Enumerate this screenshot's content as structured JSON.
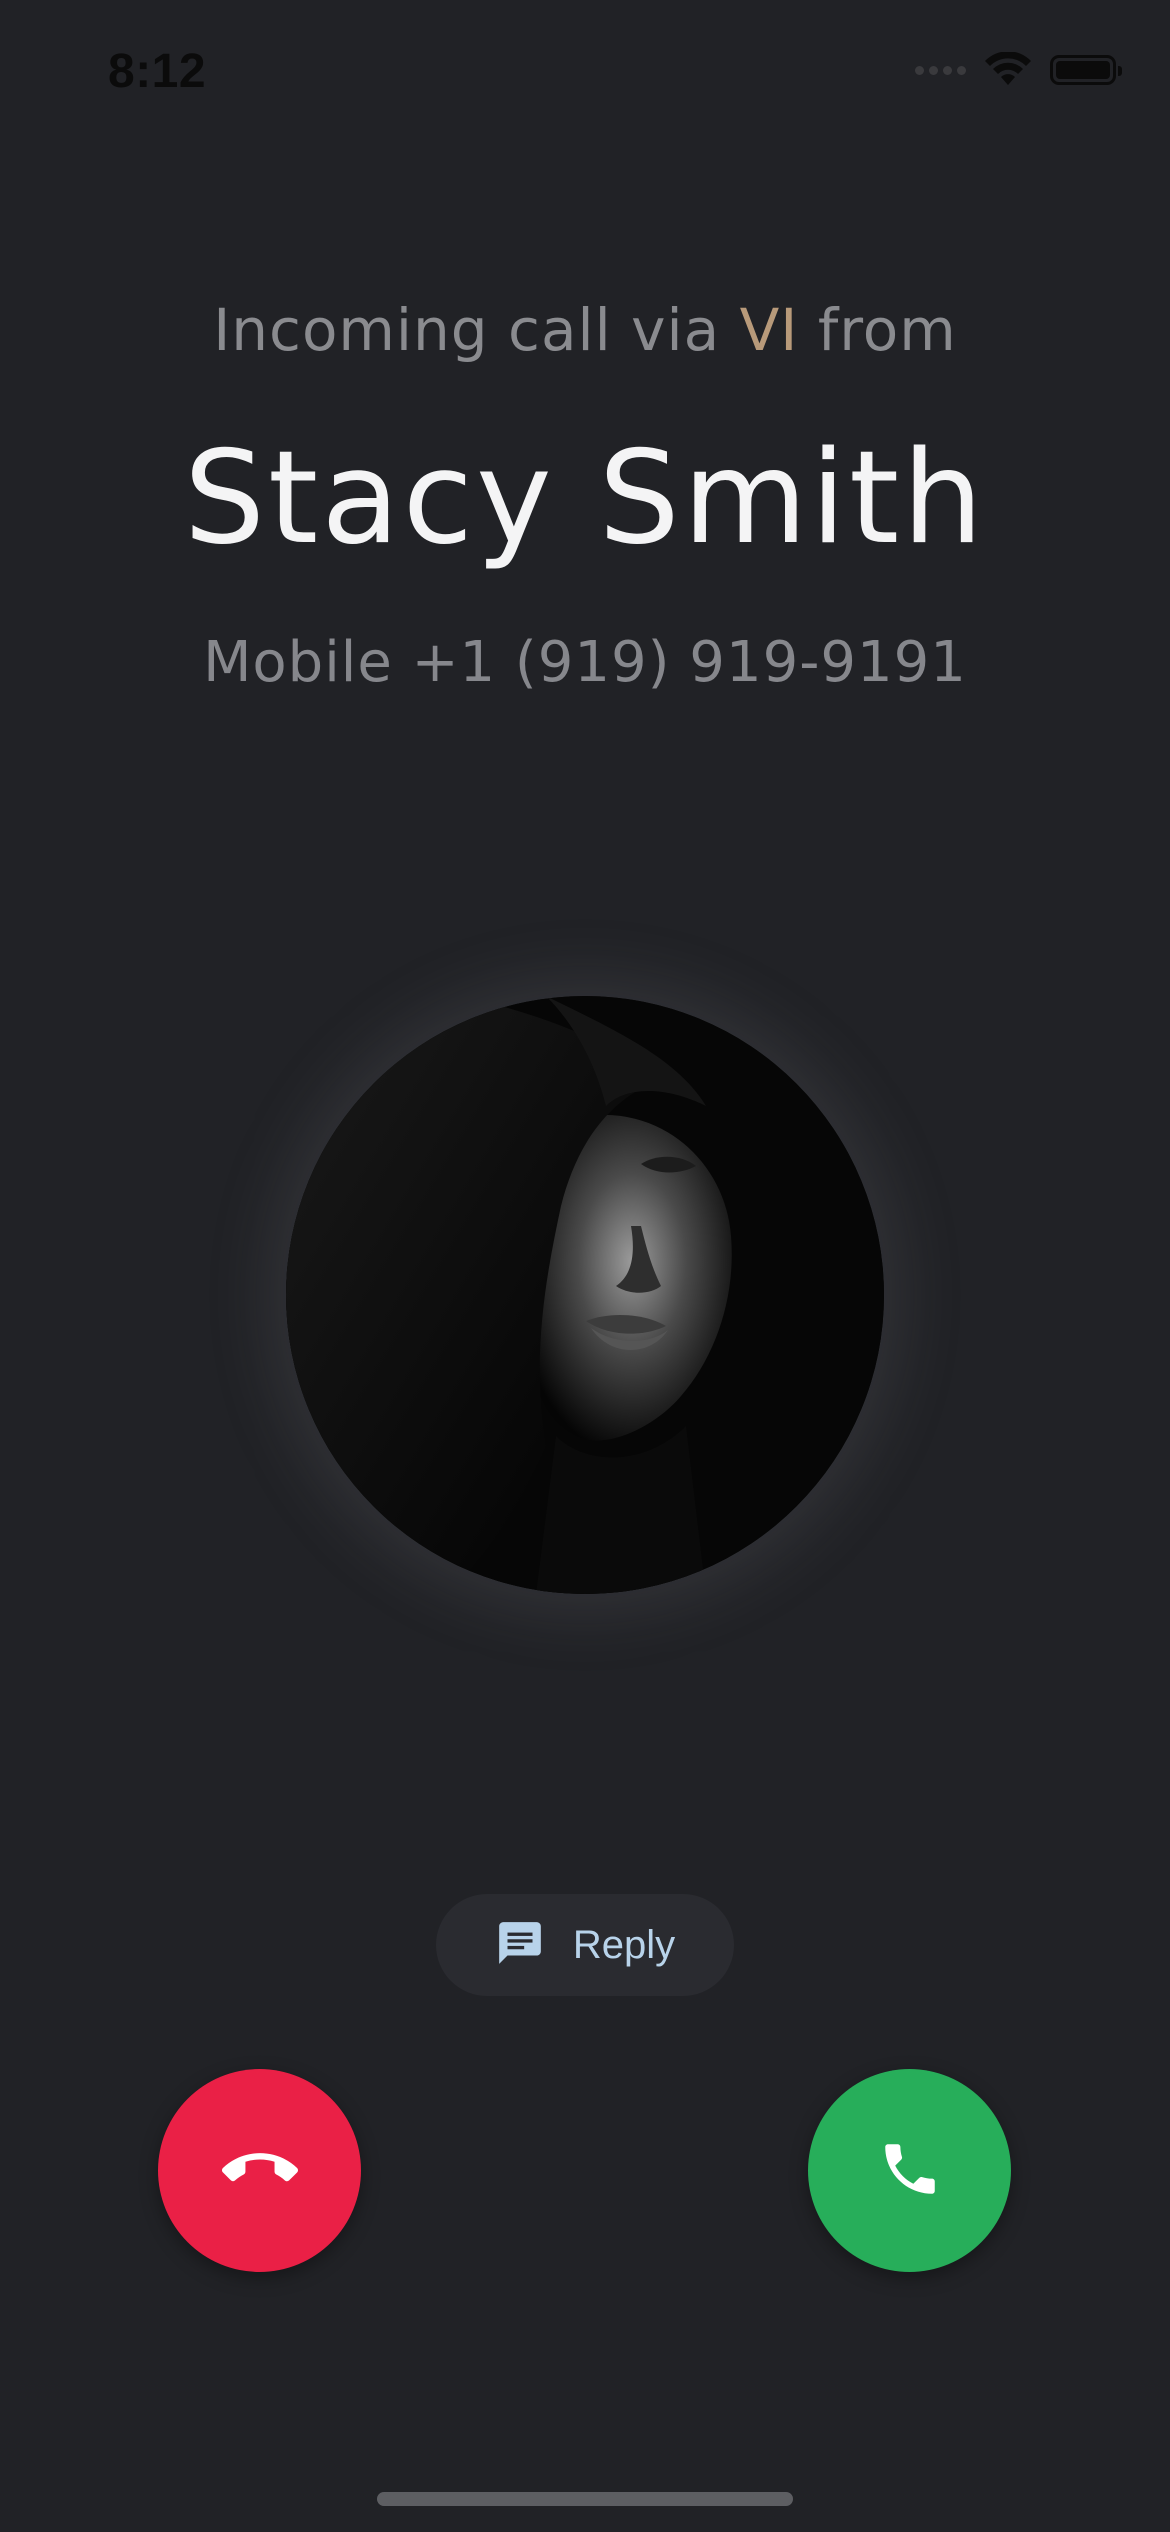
{
  "status_bar": {
    "time": "8:12",
    "signal_icon": "signal-dots-icon",
    "wifi_icon": "wifi-icon",
    "battery_icon": "battery-icon"
  },
  "call": {
    "incoming_prefix": "Incoming call via",
    "carrier": "VI",
    "incoming_suffix": "from",
    "caller_name": "Stacy Smith",
    "caller_number": "Mobile +1 (919) 919-9191"
  },
  "actions": {
    "reply_label": "Reply",
    "reply_icon": "message-icon",
    "decline_icon": "hang-up-icon",
    "accept_icon": "phone-icon"
  },
  "colors": {
    "background": "#212226",
    "carrier_accent": "#b89a7a",
    "decline": "#ea2046",
    "accept": "#27ae5a",
    "reply_text": "#b8d3ea"
  }
}
